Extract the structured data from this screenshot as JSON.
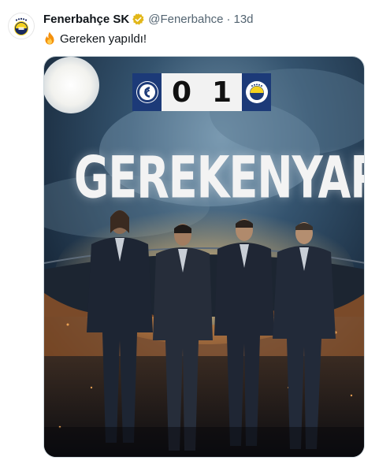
{
  "tweet": {
    "author_name": "Fenerbahçe SK",
    "handle": "@Fenerbahce",
    "separator": "·",
    "time": "13d",
    "text": "Gereken yapıldı!",
    "emoji": "fire-emoji"
  },
  "media": {
    "scoreboard": {
      "home_team_logo": "galatasaray-crest-icon",
      "home_score": "0",
      "away_score": "1",
      "away_team_logo": "fenerbahce-crest-icon"
    },
    "headline": {
      "word1": "GEREKEN",
      "word2": "YAPILDI"
    }
  },
  "colors": {
    "verified_badge": "#e2b719",
    "scoreboard_team_bg": "#1c3a78",
    "sky": "#2a4560"
  }
}
